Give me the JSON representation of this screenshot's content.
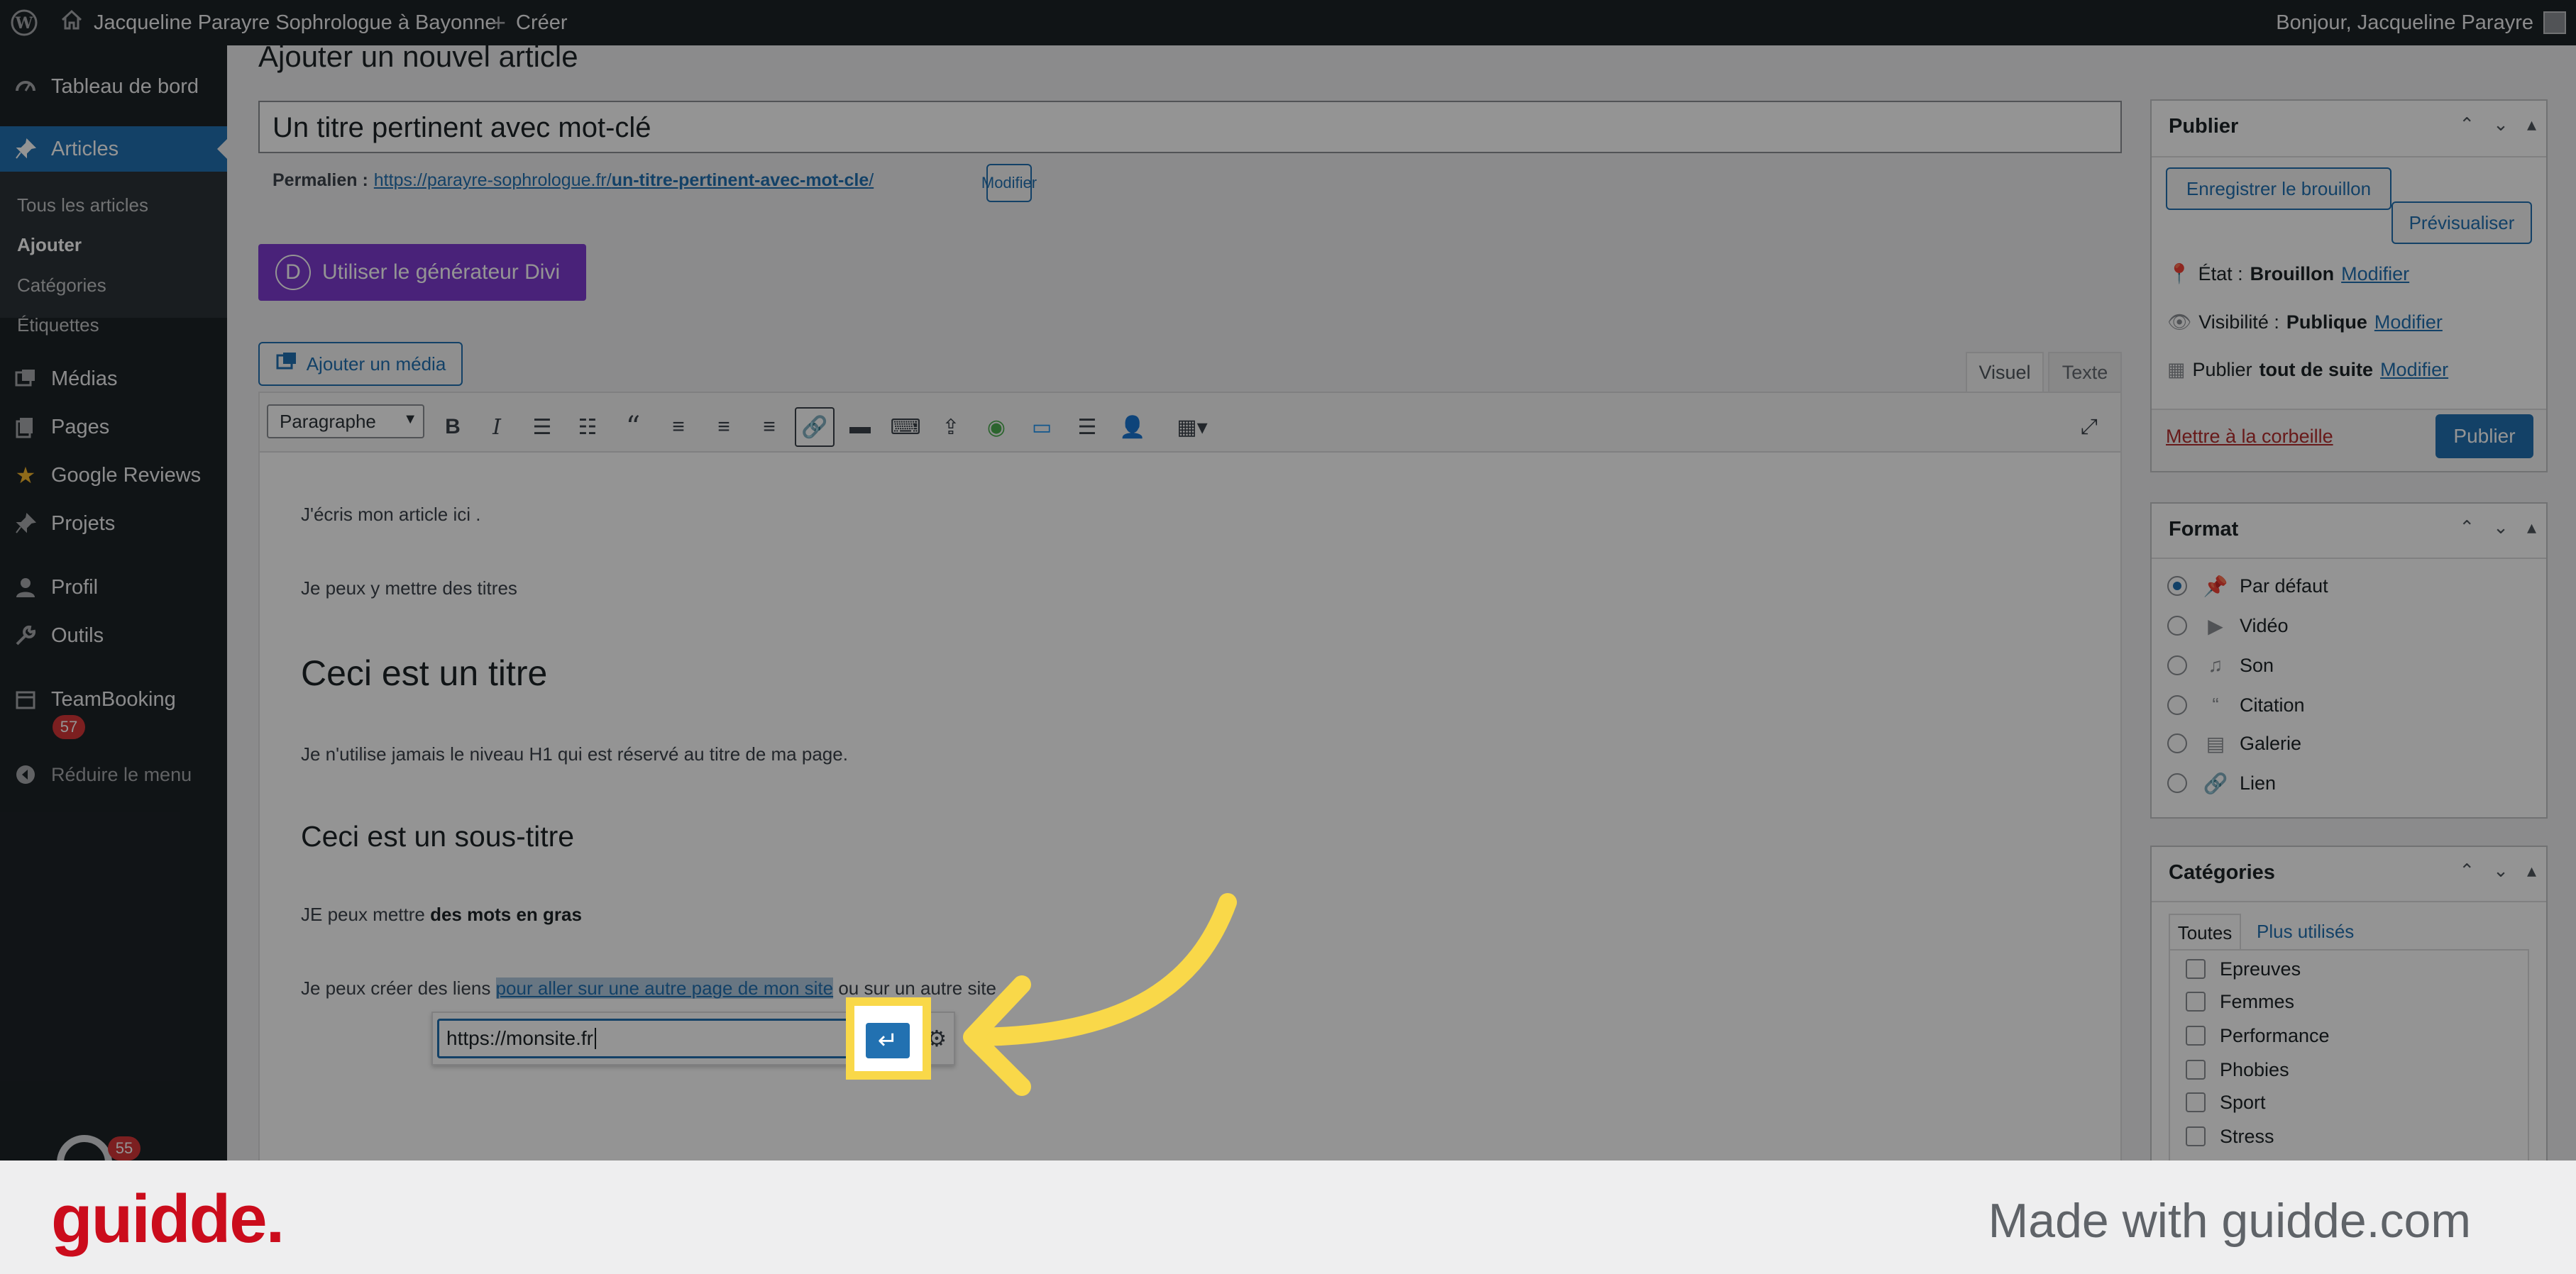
{
  "admin_bar": {
    "site_name": "Jacqueline Parayre Sophrologue à Bayonne",
    "new_label": "Créer",
    "greeting": "Bonjour, Jacqueline Parayre"
  },
  "sidebar": {
    "items": [
      {
        "label": "Tableau de bord",
        "icon": "dashboard-icon"
      },
      {
        "label": "Articles",
        "icon": "pin-icon"
      },
      {
        "label": "Médias",
        "icon": "media-icon"
      },
      {
        "label": "Pages",
        "icon": "pages-icon"
      },
      {
        "label": "Google Reviews",
        "icon": "star-icon"
      },
      {
        "label": "Projets",
        "icon": "pin-icon"
      },
      {
        "label": "Profil",
        "icon": "user-icon"
      },
      {
        "label": "Outils",
        "icon": "wrench-icon"
      },
      {
        "label": "TeamBooking",
        "icon": "calendar-icon"
      },
      {
        "label": "Réduire le menu",
        "icon": "collapse-icon"
      }
    ],
    "submenu": [
      "Tous les articles",
      "Ajouter",
      "Catégories",
      "Étiquettes"
    ],
    "teambooking_badge": "57",
    "avatar_badge": "55"
  },
  "page": {
    "heading": "Ajouter un nouvel article",
    "title_value": "Un titre pertinent avec mot-clé",
    "permalink_label": "Permalien :",
    "permalink_base": "https://parayre-sophrologue.fr/",
    "permalink_slug": "un-titre-pertinent-avec-mot-cle",
    "permalink_end": "/",
    "permalink_edit": "Modifier",
    "divi_button": "Utiliser le générateur Divi",
    "divi_letter": "D",
    "add_media": "Ajouter un média",
    "tab_visual": "Visuel",
    "tab_text": "Texte",
    "format_select": "Paragraphe"
  },
  "content": {
    "p1": "J'écris mon article ici .",
    "p2": "Je peux y mettre des titres",
    "h2": "Ceci est un titre",
    "p3": "Je n'utilise jamais le niveau H1 qui est réservé au titre de ma page.",
    "h3": "Ceci est un sous-titre",
    "p4_start": "JE peux mettre ",
    "p4_bold": "des mots en gras",
    "p5_start": "Je peux créer des liens ",
    "p5_link": "pour aller sur une autre page de mon site",
    "p5_end": " ou sur un autre site",
    "link_input_value": "https://monsite.fr"
  },
  "publish_box": {
    "title": "Publier",
    "save_draft": "Enregistrer le brouillon",
    "preview": "Prévisualiser",
    "status_label": "État :",
    "status_value": "Brouillon",
    "visibility_label": "Visibilité :",
    "visibility_value": "Publique",
    "publish_label": "Publier",
    "publish_value": "tout de suite",
    "modify": "Modifier",
    "trash": "Mettre à la corbeille",
    "publish_button": "Publier"
  },
  "format_box": {
    "title": "Format",
    "options": [
      {
        "label": "Par défaut",
        "icon": "pin-icon",
        "checked": true
      },
      {
        "label": "Vidéo",
        "icon": "video-icon",
        "checked": false
      },
      {
        "label": "Son",
        "icon": "music-icon",
        "checked": false
      },
      {
        "label": "Citation",
        "icon": "quote-icon",
        "checked": false
      },
      {
        "label": "Galerie",
        "icon": "gallery-icon",
        "checked": false
      },
      {
        "label": "Lien",
        "icon": "link-icon",
        "checked": false
      }
    ]
  },
  "categories_box": {
    "title": "Catégories",
    "tab_all": "Toutes",
    "tab_most_used": "Plus utilisés",
    "items": [
      "Epreuves",
      "Femmes",
      "Performance",
      "Phobies",
      "Sport",
      "Stress"
    ]
  },
  "footer": {
    "logo": "guidde.",
    "tagline": "Made with guidde.com"
  },
  "colors": {
    "accent": "#2271b1",
    "divi": "#7e3bd0",
    "highlight": "#f9d849",
    "guidde": "#cb0c1c"
  }
}
